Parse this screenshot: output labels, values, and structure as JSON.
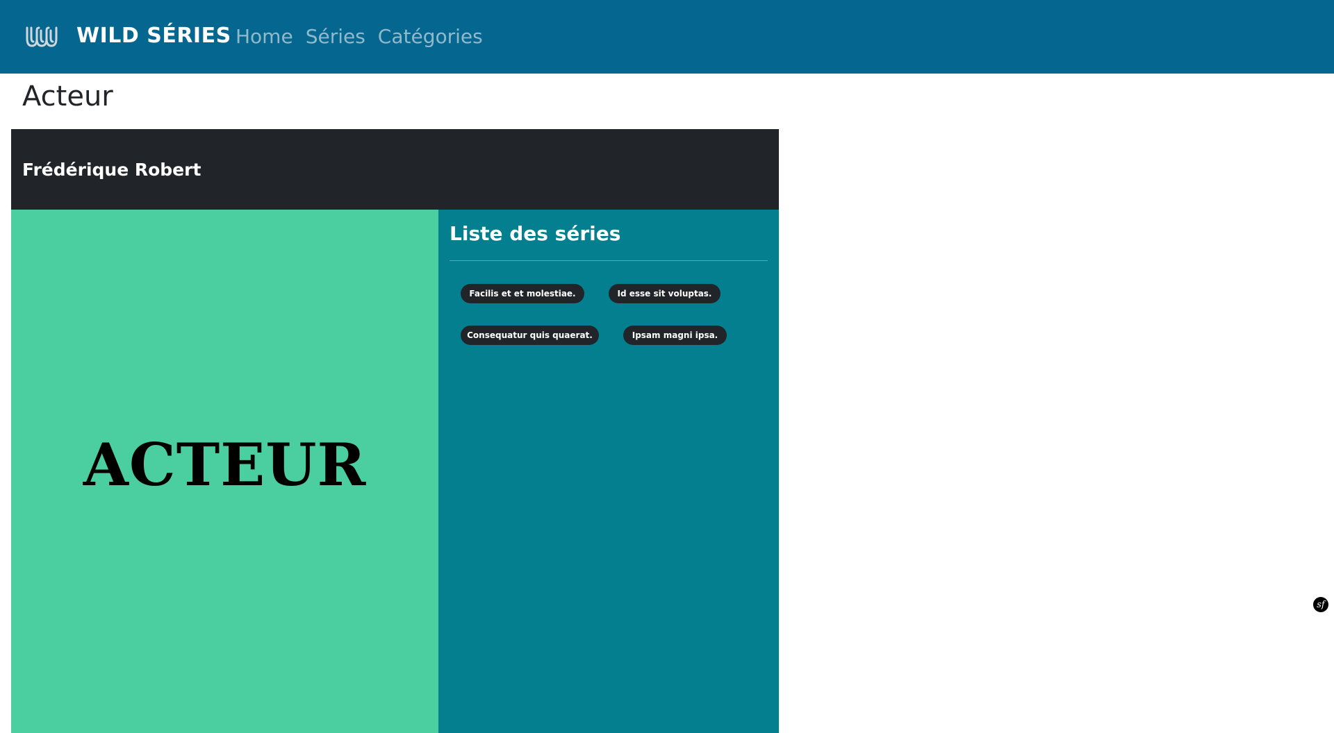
{
  "navbar": {
    "brand": "WILD SÉRIES",
    "logo_icon": "wild-logo-icon",
    "links": [
      "Home",
      "Séries",
      "Catégories"
    ]
  },
  "page": {
    "title": "Acteur"
  },
  "card": {
    "header_name": "Frédérique Robert",
    "poster_text": "ACTEUR",
    "series_title": "Liste des séries",
    "series": [
      "Facilis et et molestiae.",
      "Id esse sit voluptas.",
      "Consequatur quis quaerat.",
      "Ipsam magni ipsa."
    ]
  },
  "debug": {
    "symfony_badge": "sf",
    "icon": "symfony-toolbar-icon"
  },
  "colors": {
    "navbar": "#05668f",
    "card_header": "#212529",
    "poster": "#4bcea0",
    "series_panel": "#047f8f",
    "pill": "#212529"
  }
}
